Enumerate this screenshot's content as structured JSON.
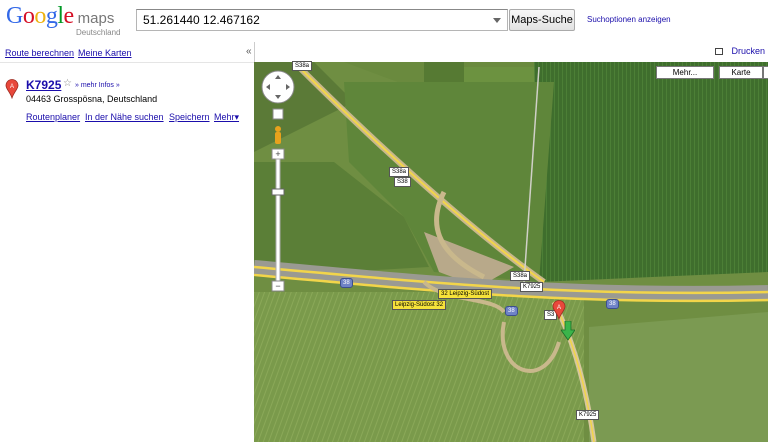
{
  "header": {
    "logo_text": "Google",
    "logo_maps": "maps",
    "logo_country": "Deutschland",
    "search_value": "51.261440 12.467162",
    "search_button": "Maps-Suche",
    "search_options": "Suchoptionen anzeigen"
  },
  "panel": {
    "route_link": "Route berechnen",
    "my_maps_link": "Meine Karten",
    "collapse": "«"
  },
  "result": {
    "marker": "A",
    "title": "K7925",
    "more_info": "» mehr Infos »",
    "address": "04463 Grosspösna, Deutschland",
    "actions": [
      "Routenplaner",
      "In der Nähe suchen",
      "Speichern",
      "Mehr▾"
    ]
  },
  "map": {
    "print": "Drucken",
    "buttons": {
      "more": "Mehr...",
      "map": "Karte"
    },
    "road_labels": {
      "s38a_top": "S38a",
      "s38a_1": "S38a",
      "s38_1": "S38",
      "s38a_2": "S38a",
      "k7925_1": "K7925",
      "k7925_2": "K7925",
      "s38_2": "S3",
      "b38_1": "38",
      "b38_2": "38",
      "b38_3": "38",
      "exit_1": "32 Leipzig-Südost",
      "exit_2": "Leipzig-Südost 32"
    }
  },
  "colors": {
    "link": "#1a0dab",
    "marker_red": "#e8483b",
    "arrow_green": "#3bb54a",
    "field_light": "#6d8d3e",
    "field_dark": "#3e6d2c"
  }
}
